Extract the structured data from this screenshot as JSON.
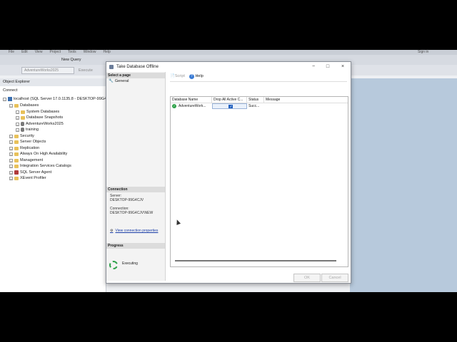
{
  "topbar": {
    "menu": [
      "File",
      "Edit",
      "View",
      "Project",
      "Tools",
      "Window",
      "Help"
    ],
    "signin": "Sign in"
  },
  "toolbar": {
    "new_query": "New Query",
    "database": "AdventureWorks2025",
    "execute": "Execute"
  },
  "object_explorer": {
    "title": "Object Explorer",
    "connect": "Connect",
    "server": "localhost (SQL Server 17.0.1135.8 - DESKTOP-99G4C",
    "databases": "Databases",
    "system_databases": "System Databases",
    "database_snapshots": "Database Snapshots",
    "adventureworks": "AdventureWorks2025",
    "training": "training",
    "security": "Security",
    "server_objects": "Server Objects",
    "replication": "Replication",
    "always_on": "Always On High Availability",
    "management": "Management",
    "integration_services": "Integration Services Catalogs",
    "sql_agent": "SQL Server Agent",
    "xevent": "XEvent Profiler"
  },
  "dialog": {
    "title": "Take Database Offline",
    "select_page": "Select a page",
    "page_general": "General",
    "script": "Script",
    "help": "Help",
    "connection_hdr": "Connection",
    "server_label": "Server:",
    "server_value": "DESKTOP-99G4CJV",
    "connection_label": "Connection:",
    "connection_value": "DESKTOP-99G4CJV\\NEW",
    "view_props": "View connection properties",
    "progress_hdr": "Progress",
    "progress_status": "Executing",
    "ok": "OK",
    "cancel": "Cancel",
    "grid": {
      "columns": [
        "Database Name",
        "Drop All Active C...",
        "Status",
        "Message"
      ],
      "rows": [
        {
          "name": "AdventureWork...",
          "drop": true,
          "status": "Succ...",
          "message": ""
        }
      ]
    }
  },
  "colors": {
    "accent": "#1f5fbf",
    "success": "#2fa24a",
    "link": "#1c3fa8"
  }
}
